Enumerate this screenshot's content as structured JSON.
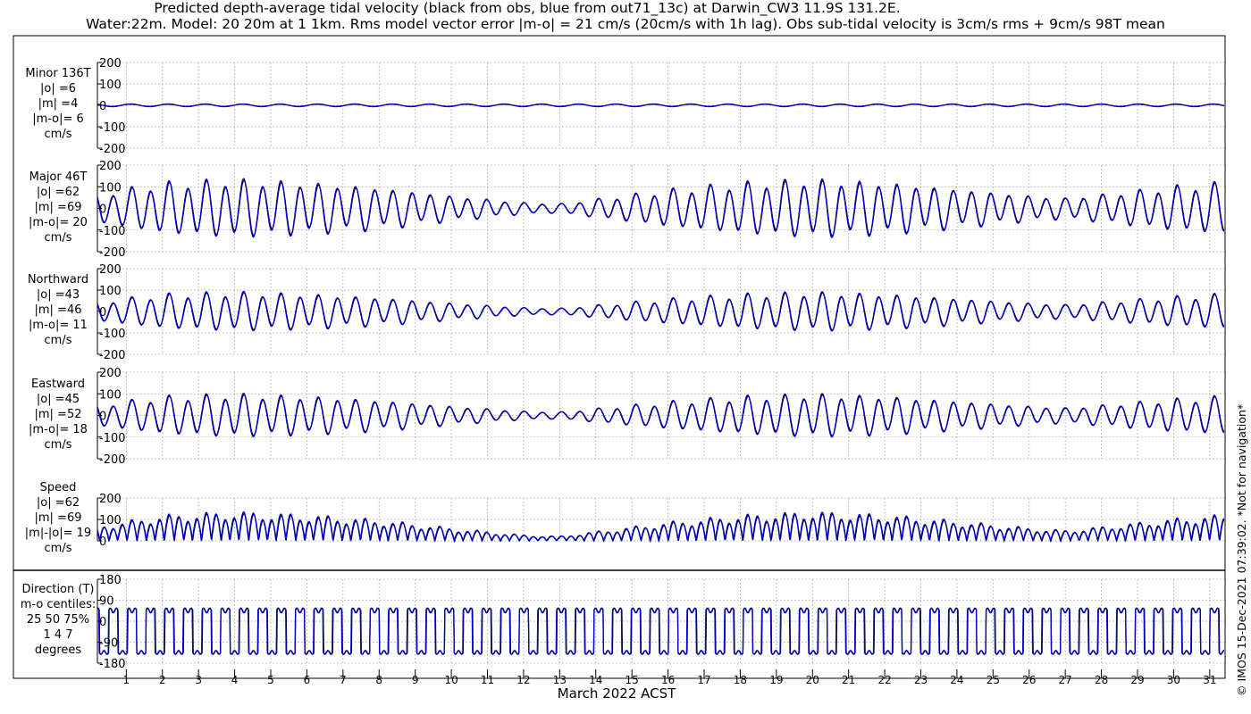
{
  "title": {
    "line1": "Predicted depth-average tidal velocity (black from obs, blue from out71_13c) at Darwin_CW3 11.9S 131.2E.",
    "line2": "Water:22m. Model: 20 20m at 1 1km. Rms model vector error |m-o| = 21 cm/s (20cm/s with 1h lag). Obs sub-tidal velocity is 3cm/s rms + 9cm/s 98T mean"
  },
  "xlabel": "March 2022 ACST",
  "copyright": "© IMOS 15-Dec-2021 07:39:02. *Not for navigation*",
  "colors": {
    "obs": "#000000",
    "model": "#0000cc",
    "grid": "#999999"
  },
  "chart_data": {
    "type": "line",
    "x": {
      "unit": "day of March 2022",
      "range": [
        0.2,
        31.4
      ],
      "ticks": [
        "1",
        "2",
        "3",
        "4",
        "5",
        "6",
        "7",
        "8",
        "9",
        "10",
        "11",
        "12",
        "13",
        "14",
        "15",
        "16",
        "17",
        "18",
        "19",
        "20",
        "21",
        "22",
        "23",
        "24",
        "25",
        "26",
        "27",
        "28",
        "29",
        "30",
        "31"
      ]
    },
    "series_names": [
      "obs",
      "model"
    ],
    "panels": [
      {
        "id": "minor",
        "label": [
          "Minor 136T",
          "|o| =6",
          "|m| =4",
          "|m-o|= 6",
          "cm/s"
        ],
        "ylim": [
          -200,
          200
        ],
        "yticks": [
          "200",
          "100",
          "0",
          "-100",
          "-200"
        ],
        "ytick_values": [
          200,
          100,
          0,
          -100,
          -200
        ],
        "amplitude_obs": 8,
        "amplitude_model": 6
      },
      {
        "id": "major",
        "label": [
          "Major 46T",
          "|o| =62",
          "|m| =69",
          "|m-o|= 20",
          "cm/s"
        ],
        "ylim": [
          -200,
          200
        ],
        "yticks": [
          "200",
          "100",
          "0",
          "-100",
          "-200"
        ],
        "ytick_values": [
          200,
          100,
          0,
          -100,
          -200
        ],
        "amplitude_obs": 120,
        "amplitude_model": 128
      },
      {
        "id": "northward",
        "label": [
          "Northward",
          "|o| =43",
          "|m| =46",
          "|m-o|= 11",
          "cm/s"
        ],
        "ylim": [
          -200,
          200
        ],
        "yticks": [
          "200",
          "100",
          "0",
          "-100",
          "-200"
        ],
        "ytick_values": [
          200,
          100,
          0,
          -100,
          -200
        ],
        "amplitude_obs": 82,
        "amplitude_model": 88
      },
      {
        "id": "eastward",
        "label": [
          "Eastward",
          "|o| =45",
          "|m| =52",
          "|m-o|= 18",
          "cm/s"
        ],
        "ylim": [
          -200,
          200
        ],
        "yticks": [
          "200",
          "100",
          "0",
          "-100",
          "-200"
        ],
        "ytick_values": [
          200,
          100,
          0,
          -100,
          -200
        ],
        "amplitude_obs": 88,
        "amplitude_model": 96
      },
      {
        "id": "speed",
        "label": [
          "Speed",
          "|o| =62",
          "|m| =69",
          "|m|-|o|= 19",
          "cm/s"
        ],
        "ylim": [
          0,
          200
        ],
        "yticks": [
          "200",
          "100",
          "0"
        ],
        "ytick_values": [
          200,
          100,
          0
        ],
        "amplitude_obs": 120,
        "amplitude_model": 128
      },
      {
        "id": "direction",
        "label": [
          "Direction (T)",
          "m-o centiles:",
          "25  50  75%",
          "1   4   7",
          "degrees"
        ],
        "ylim": [
          -180,
          180
        ],
        "yticks": [
          "180",
          "90",
          "0",
          "-90",
          "-180"
        ],
        "ytick_values": [
          180,
          90,
          0,
          -90,
          -180
        ]
      }
    ],
    "envelope_note": "spring tides near days 3-5 and 19-21, neap near day 12-13 and 27",
    "approx_major_amplitude_by_day": [
      [
        0.5,
        70
      ],
      [
        2,
        110
      ],
      [
        4,
        125
      ],
      [
        6,
        112
      ],
      [
        8,
        90
      ],
      [
        10,
        55
      ],
      [
        12,
        25
      ],
      [
        13,
        20
      ],
      [
        14,
        40
      ],
      [
        16,
        80
      ],
      [
        18,
        110
      ],
      [
        20,
        125
      ],
      [
        22,
        112
      ],
      [
        24,
        85
      ],
      [
        26,
        55
      ],
      [
        27,
        45
      ],
      [
        28,
        60
      ],
      [
        30,
        95
      ],
      [
        31.3,
        110
      ]
    ]
  }
}
